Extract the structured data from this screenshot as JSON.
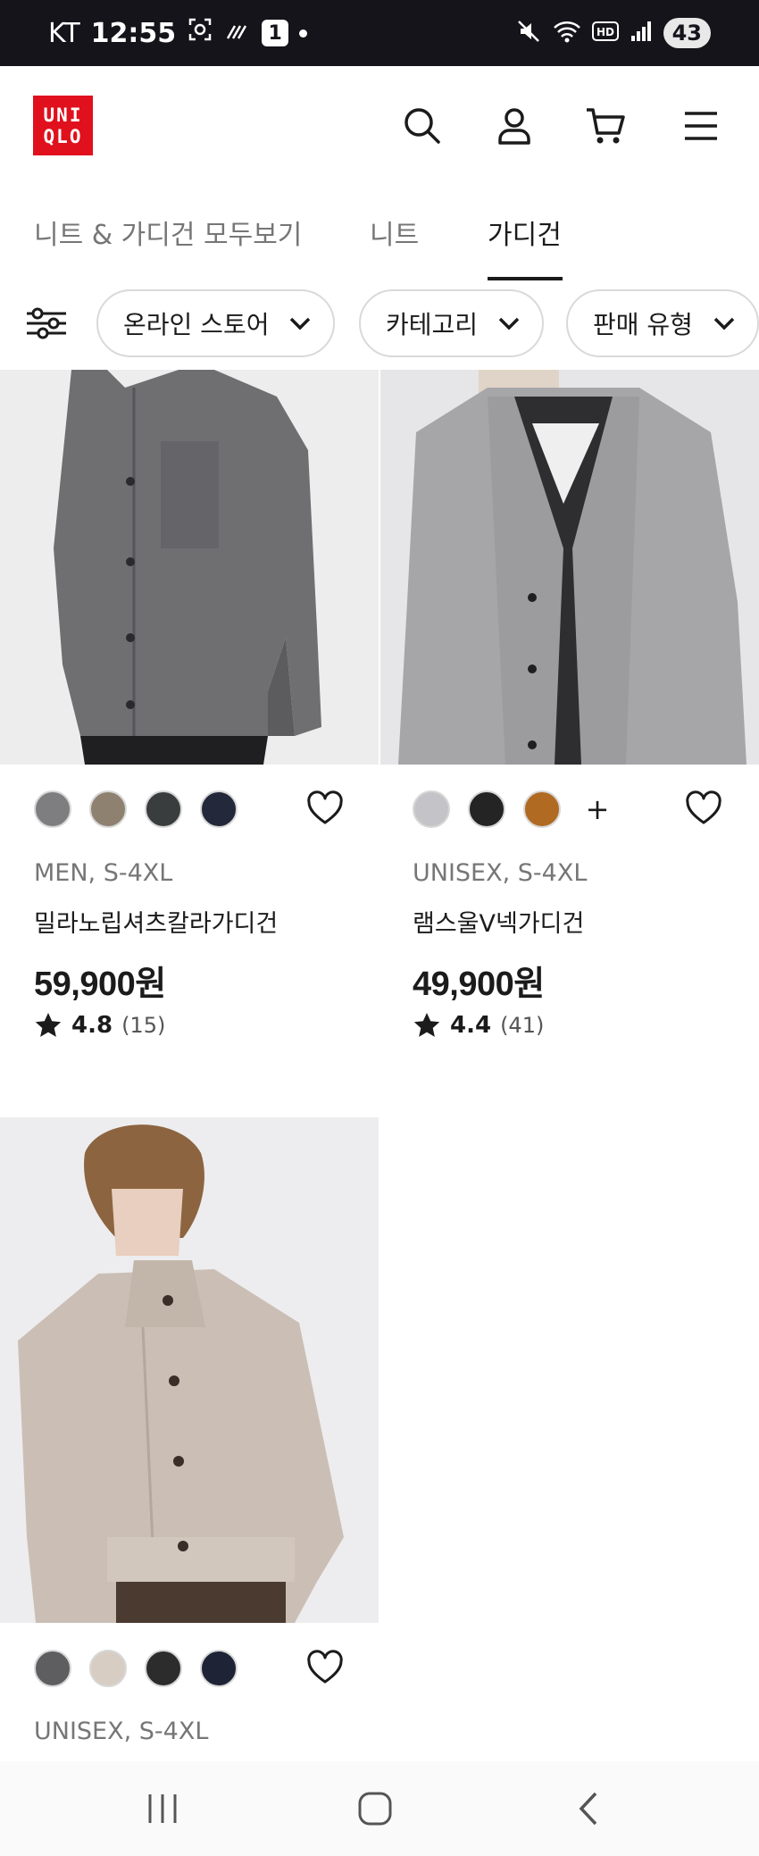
{
  "status_bar": {
    "carrier": "KT",
    "time": "12:55",
    "notification_count": "1",
    "battery": "43"
  },
  "header": {
    "logo_line1": "UNI",
    "logo_line2": "QLO",
    "brand_color": "#e0101d",
    "icons": [
      "search-icon",
      "account-icon",
      "cart-icon",
      "menu-icon"
    ]
  },
  "tabs": [
    {
      "label": "니트 & 가디건 모두보기",
      "active": false
    },
    {
      "label": "니트",
      "active": false
    },
    {
      "label": "가디건",
      "active": true
    }
  ],
  "filters": [
    {
      "label": "온라인 스토어"
    },
    {
      "label": "카테고리"
    },
    {
      "label": "판매 유형"
    }
  ],
  "products": [
    {
      "swatches": [
        "#7e7e80",
        "#8f8170",
        "#3a3d3e",
        "#23283a"
      ],
      "has_more_colors": false,
      "meta": "MEN, S-4XL",
      "name": "밀라노립셔츠칼라가디건",
      "price": "59,900원",
      "rating": "4.8",
      "review_count": "(15)"
    },
    {
      "swatches": [
        "#c4c4c8",
        "#242424",
        "#b06a22"
      ],
      "has_more_colors": true,
      "more_label": "+",
      "meta": "UNISEX, S-4XL",
      "name": "램스울V넥가디건",
      "price": "49,900원",
      "rating": "4.4",
      "review_count": "(41)"
    },
    {
      "swatches": [
        "#5e5e60",
        "#d8cdc2",
        "#2c2c2c",
        "#1e2435"
      ],
      "has_more_colors": false,
      "meta": "UNISEX, S-4XL"
    }
  ]
}
